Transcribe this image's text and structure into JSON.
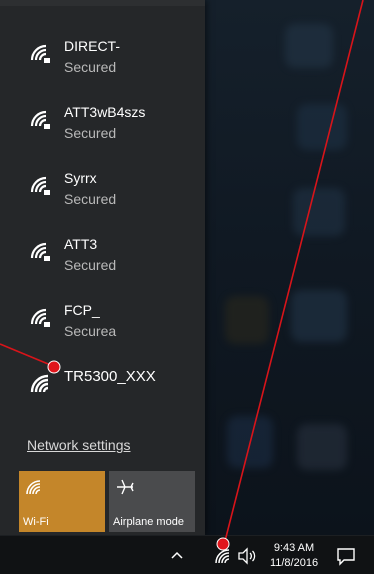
{
  "networks": [
    {
      "name": "DIRECT-",
      "status": "Secured",
      "icon": "wifi-secured-icon"
    },
    {
      "name": "ATT3wB4szs",
      "status": "Secured",
      "icon": "wifi-secured-icon"
    },
    {
      "name": "Syrrx",
      "status": "Secured",
      "icon": "wifi-secured-icon"
    },
    {
      "name": "ATT3",
      "status": "Secured",
      "icon": "wifi-secured-icon"
    },
    {
      "name": "FCP_",
      "status": "Securea",
      "icon": "wifi-secured-icon"
    },
    {
      "name": "TR5300_XXX",
      "status": "",
      "icon": "wifi-icon"
    }
  ],
  "network_settings_label": "Network settings",
  "quick_actions": {
    "wifi_label": "Wi-Fi",
    "wifi_icon": "wifi-icon",
    "airplane_label": "Airplane mode",
    "airplane_icon": "airplane-icon"
  },
  "taskbar": {
    "time": "9:43 AM",
    "date": "11/8/2016",
    "tray_icons": [
      "chevron-up-icon",
      "wifi-icon",
      "volume-icon",
      "action-center-icon"
    ]
  },
  "colors": {
    "flyout_bg": "#26282a",
    "wifi_tile": "#c4862a",
    "airplane_tile": "#4a4b4d",
    "annotation": "#d8141a"
  }
}
